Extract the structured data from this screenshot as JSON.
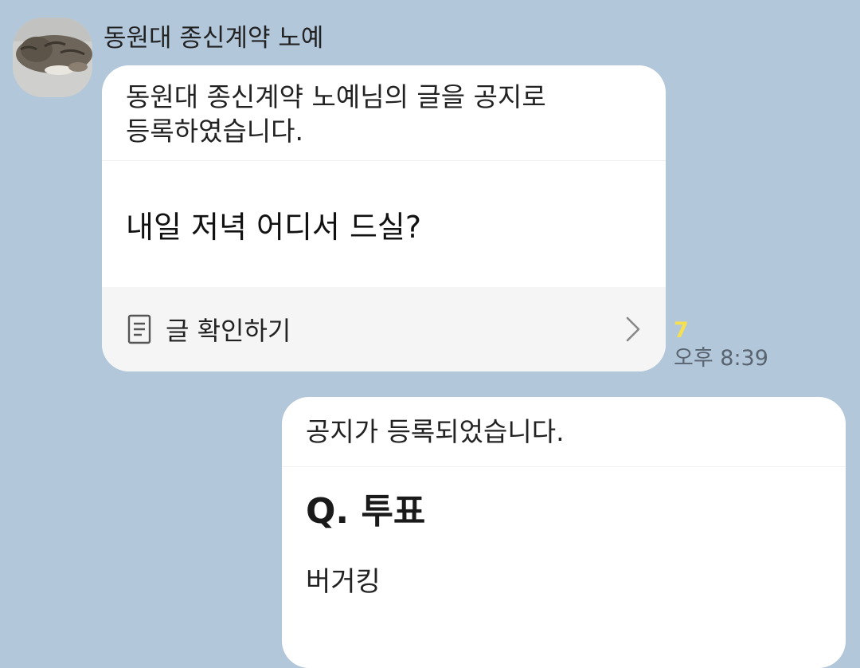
{
  "sender": {
    "name": "동원대 종신계약 노예"
  },
  "notice_message": {
    "header_line1": "동원대 종신계약 노예님의 글을 공지로",
    "header_line2": "등록하였습니다.",
    "body": "내일 저녁 어디서 드실?",
    "footer_label": "글 확인하기",
    "read_count": "7",
    "time": "오후 8:39"
  },
  "poll_message": {
    "header": "공지가 등록되었습니다.",
    "question": "Q. 투표",
    "options": [
      "버거킹"
    ]
  },
  "colors": {
    "background": "#b2c7da",
    "bubble": "#ffffff",
    "footer": "#f5f5f5",
    "read_count": "#f5e04f",
    "time": "#5a6470"
  },
  "icons": {
    "footer": "document-icon",
    "footer_arrow": "chevron-right-icon",
    "avatar": "cat-photo"
  }
}
